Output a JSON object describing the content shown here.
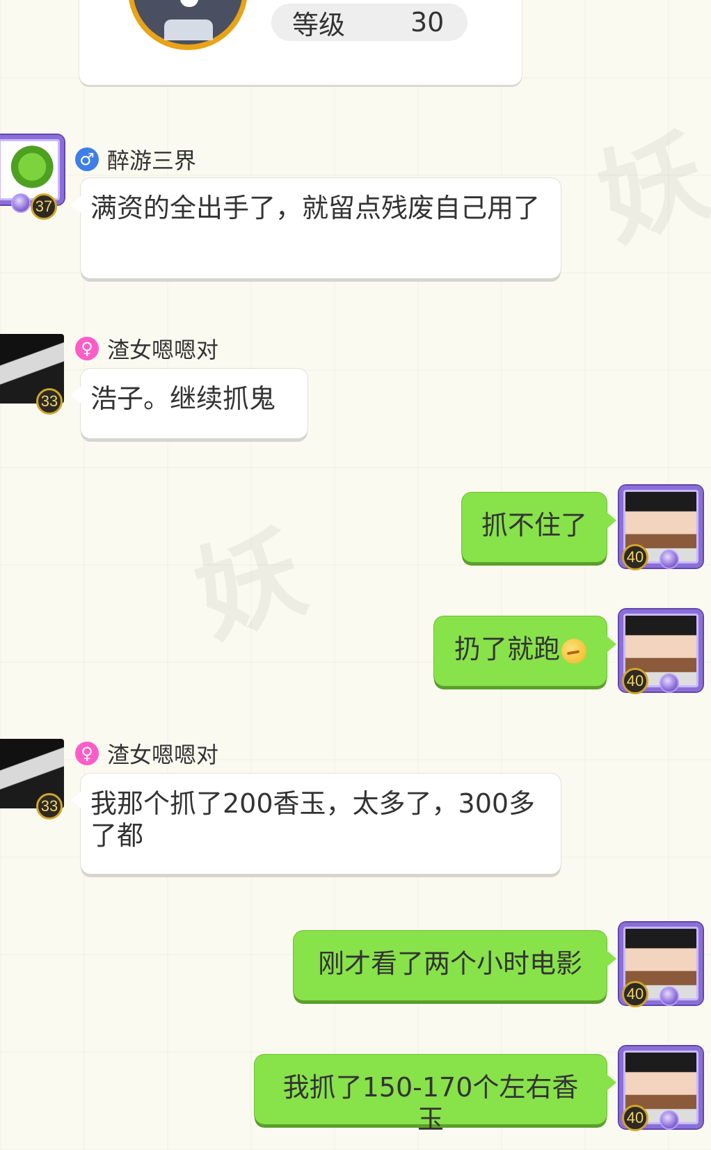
{
  "profile": {
    "level_label": "等级",
    "level_value": "30"
  },
  "messages": [
    {
      "side": "left",
      "name": "醉游三界",
      "gender_symbol": "♂",
      "level": "37",
      "text": "满资的全出手了，就留点残废自己用了"
    },
    {
      "side": "left",
      "name": "渣女嗯嗯对",
      "gender_symbol": "♀",
      "level": "33",
      "text": "浩子。继续抓鬼"
    },
    {
      "side": "right",
      "level": "40",
      "text": "抓不住了"
    },
    {
      "side": "right",
      "level": "40",
      "text": "扔了就跑"
    },
    {
      "side": "left",
      "name": "渣女嗯嗯对",
      "gender_symbol": "♀",
      "level": "33",
      "text": "我那个抓了200香玉，太多了，300多了都"
    },
    {
      "side": "right",
      "level": "40",
      "text": "刚才看了两个小时电影"
    },
    {
      "side": "right",
      "level": "40",
      "text": "我抓了150-170个左右香玉"
    }
  ]
}
